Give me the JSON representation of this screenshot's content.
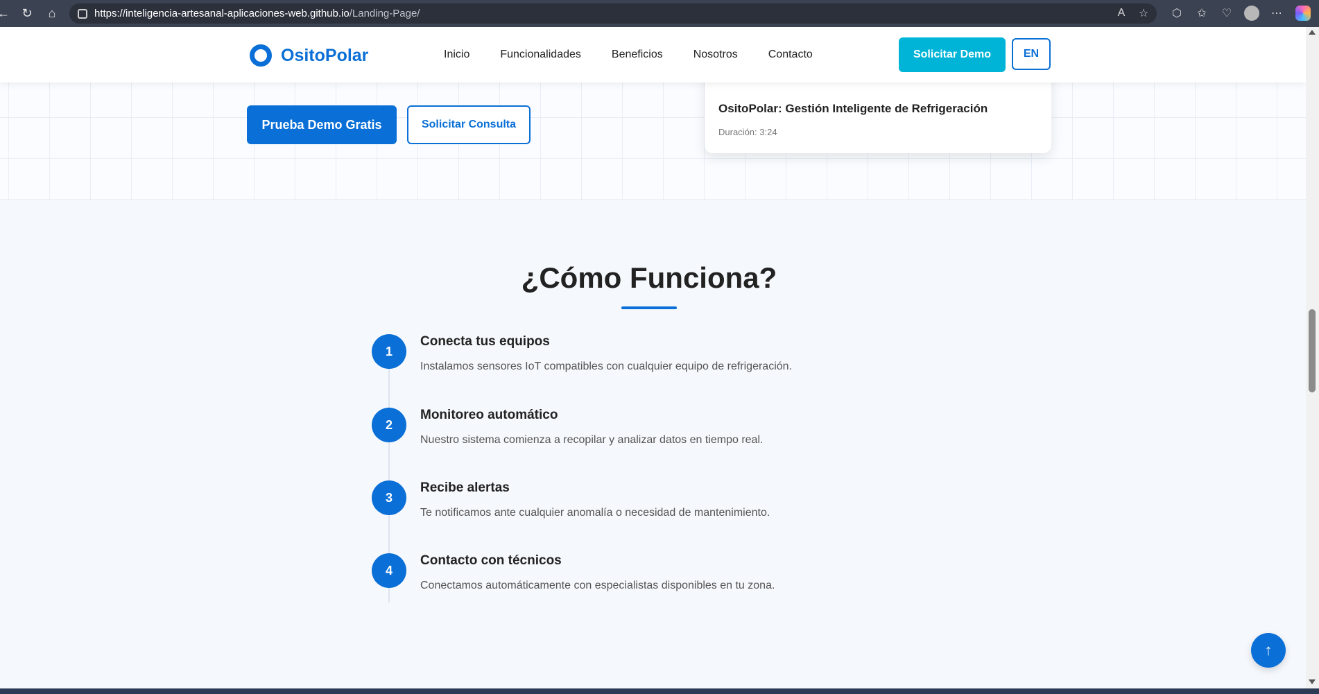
{
  "browser": {
    "url_domain": "https://inteligencia-artesanal-aplicaciones-web.github.io",
    "url_path": "/Landing-Page/",
    "icons": [
      "back-icon",
      "refresh-icon",
      "home-icon",
      "lock-icon",
      "read-aloud-icon",
      "favorite-icon",
      "extensions-icon",
      "favorites-icon",
      "health-icon",
      "profile-icon",
      "more-icon",
      "copilot-icon"
    ]
  },
  "header": {
    "logo_text": "OsitoPolar",
    "nav": [
      "Inicio",
      "Funcionalidades",
      "Beneficios",
      "Nosotros",
      "Contacto"
    ],
    "demo_button": "Solicitar Demo",
    "lang_button": "EN"
  },
  "hero": {
    "primary_button": "Prueba Demo Gratis",
    "secondary_button": "Solicitar Consulta",
    "video_title": "OsitoPolar: Gestión Inteligente de Refrigeración",
    "video_duration": "Duración: 3:24"
  },
  "how_it_works": {
    "title": "¿Cómo Funciona?",
    "steps": [
      {
        "num": "1",
        "title": "Conecta tus equipos",
        "desc": "Instalamos sensores IoT compatibles con cualquier equipo de refrigeración."
      },
      {
        "num": "2",
        "title": "Monitoreo automático",
        "desc": "Nuestro sistema comienza a recopilar y analizar datos en tiempo real."
      },
      {
        "num": "3",
        "title": "Recibe alertas",
        "desc": "Te notificamos ante cualquier anomalía o necesidad de mantenimiento."
      },
      {
        "num": "4",
        "title": "Contacto con técnicos",
        "desc": "Conectamos automáticamente con especialistas disponibles en tu zona."
      }
    ]
  },
  "back_to_top_icon": "arrow-up-icon",
  "colors": {
    "primary": "#0a6fd6",
    "accent": "#00b4d8",
    "browser_bar": "#3b4252"
  }
}
